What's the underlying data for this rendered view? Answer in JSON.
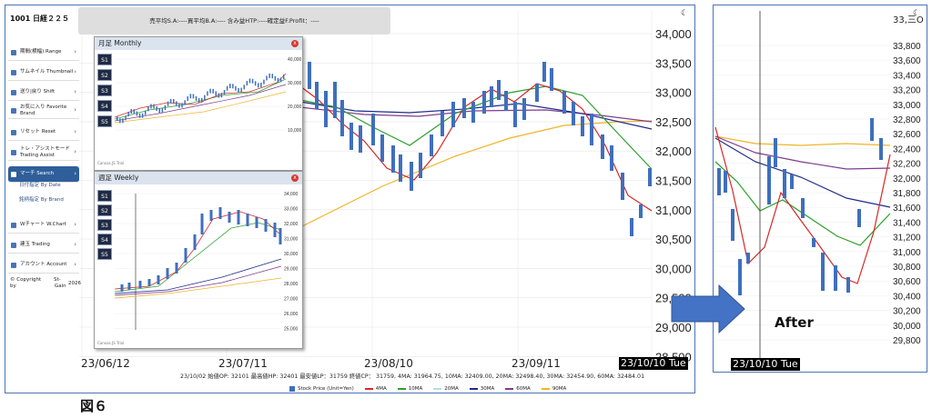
{
  "header": {
    "title": "1001 日経２２５",
    "summary": "売平均S.A:----買平均B.A:---- 含み益HTP:----確定益F.Profit：----",
    "theme_icon": "moon-icon"
  },
  "sidebar": {
    "items": [
      {
        "label": "期間(横幅) Range",
        "icon": "calendar-icon"
      },
      {
        "label": "サムネイル Thumbnail",
        "icon": "thumbnail-icon"
      },
      {
        "label": "送り|戻り Shift",
        "icon": "shift-icon"
      },
      {
        "label": "お気に入り Favorite　Brand",
        "icon": "star-icon"
      },
      {
        "label": "リセット Reset",
        "icon": "reset-icon"
      },
      {
        "label": "トレ・アシストモード Trading Assist",
        "icon": "assist-icon"
      },
      {
        "label": "マーチ Search",
        "icon": "search-icon",
        "active": true
      },
      {
        "label": "Wチャート W.Chart",
        "icon": "chart-icon"
      },
      {
        "label": "建玉 Trading",
        "icon": "trading-icon"
      },
      {
        "label": "アカウント Account",
        "icon": "account-icon"
      }
    ],
    "sub_items": [
      "日付指定 By Date",
      "銘柄指定 By Brand"
    ],
    "copyright": [
      "© Copyright",
      "by",
      "St-",
      "Gain",
      "2026"
    ]
  },
  "main_chart": {
    "y_ticks": [
      "34,000",
      "33,500",
      "33,000",
      "32,500",
      "32,000",
      "31,500",
      "31,000",
      "30,500",
      "30,000",
      "29,500",
      "29,000",
      "28,500"
    ],
    "x_ticks": [
      "23/06/12",
      "23/07/11",
      "23/08/10",
      "23/09/11"
    ],
    "date_tag": "23/10/10 Tue",
    "info_line": "23/10/02 始値OP: 32101  最高値HP: 32401 最安値LP：31759  終値CP： 31759, 4MA: 31964.75, 10MA: 32409.00, 20MA: 32498.40, 30MA: 32454.90, 60MA: 32484.01",
    "legend": [
      {
        "label": "Stock Price (Unit=Yen)",
        "color": "#3f6fbd",
        "kind": "box"
      },
      {
        "label": "4MA",
        "color": "#d62728"
      },
      {
        "label": "10MA",
        "color": "#2ca02c"
      },
      {
        "label": "20MA",
        "color": "#aee0ea"
      },
      {
        "label": "30MA",
        "color": "#1f2d8a"
      },
      {
        "label": "60MA",
        "color": "#7e3c8f"
      },
      {
        "label": "90MA",
        "color": "#f0b429"
      }
    ]
  },
  "popup_monthly": {
    "title": "月足 Monthly",
    "buttons": [
      "S1",
      "S2",
      "S3",
      "S4",
      "S5"
    ],
    "y_ticks": [
      "40,000",
      "30,000",
      "20,000",
      "10,000"
    ],
    "footer": "Canvas.JS Trial"
  },
  "popup_weekly": {
    "title": "週足 Weekly",
    "buttons": [
      "S1",
      "S2",
      "S3",
      "S4",
      "S5"
    ],
    "y_ticks": [
      "34,000",
      "33,000",
      "32,000",
      "31,000",
      "30,000",
      "29,000",
      "28,000",
      "27,000",
      "26,000",
      "25,000"
    ],
    "footer": "Canvas.JS Trial"
  },
  "after_chart": {
    "y_ticks": [
      "33,800",
      "33,600",
      "33,400",
      "33,200",
      "33,000",
      "32,800",
      "32,600",
      "32,400",
      "32,200",
      "32,000",
      "31,800",
      "31,600",
      "31,400",
      "31,200",
      "31,000",
      "30,800",
      "30,600",
      "30,400",
      "30,200",
      "30,000",
      "29,800"
    ],
    "top_tick": "33,三O",
    "date_tag": "23/10/10 Tue",
    "label": "After"
  },
  "figure_label": "図６",
  "colors": {
    "accent": "#4a74b8",
    "candle": "#3f6fbd",
    "ma4": "#d62728",
    "ma10": "#2ca02c",
    "ma30": "#1f2d8a",
    "ma60": "#7e3c8f",
    "ma90": "#f0b429"
  }
}
